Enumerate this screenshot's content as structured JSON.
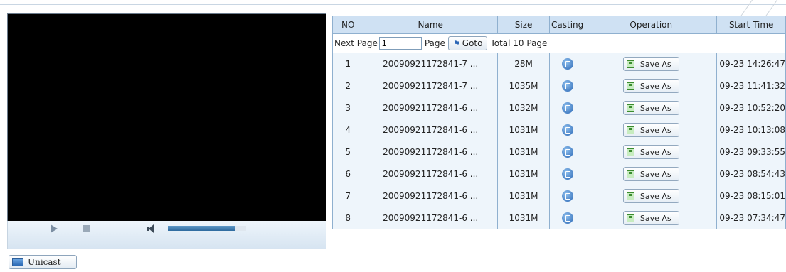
{
  "player": {
    "play_icon": "play-icon",
    "stop_icon": "stop-icon",
    "volume_icon": "speaker-icon",
    "volume_level": 0.86
  },
  "unicast_label": "Unicast",
  "table": {
    "headers": [
      "NO",
      "Name",
      "Size",
      "Casting",
      "Operation",
      "Start Time"
    ],
    "pager": {
      "next_page_label": "Next Page",
      "page_value": "1",
      "page_label": "Page",
      "goto_label": "Goto",
      "total_label": "Total 10  Page"
    },
    "save_label": "Save As",
    "rows": [
      {
        "no": "1",
        "name": "20090921172841-7 ...",
        "size": "28M",
        "start": "09-23 14:26:47"
      },
      {
        "no": "2",
        "name": "20090921172841-7 ...",
        "size": "1035M",
        "start": "09-23 11:41:32"
      },
      {
        "no": "3",
        "name": "20090921172841-6 ...",
        "size": "1032M",
        "start": "09-23 10:52:20"
      },
      {
        "no": "4",
        "name": "20090921172841-6 ...",
        "size": "1031M",
        "start": "09-23 10:13:08"
      },
      {
        "no": "5",
        "name": "20090921172841-6 ...",
        "size": "1031M",
        "start": "09-23 09:33:55"
      },
      {
        "no": "6",
        "name": "20090921172841-6 ...",
        "size": "1031M",
        "start": "09-23 08:54:43"
      },
      {
        "no": "7",
        "name": "20090921172841-6 ...",
        "size": "1031M",
        "start": "09-23 08:15:01"
      },
      {
        "no": "8",
        "name": "20090921172841-6 ...",
        "size": "1031M",
        "start": "09-23 07:34:47"
      }
    ]
  },
  "colors": {
    "header_bg": "#cfe1f3",
    "row_bg": "#eef5fb",
    "border": "#8fb0cf"
  }
}
